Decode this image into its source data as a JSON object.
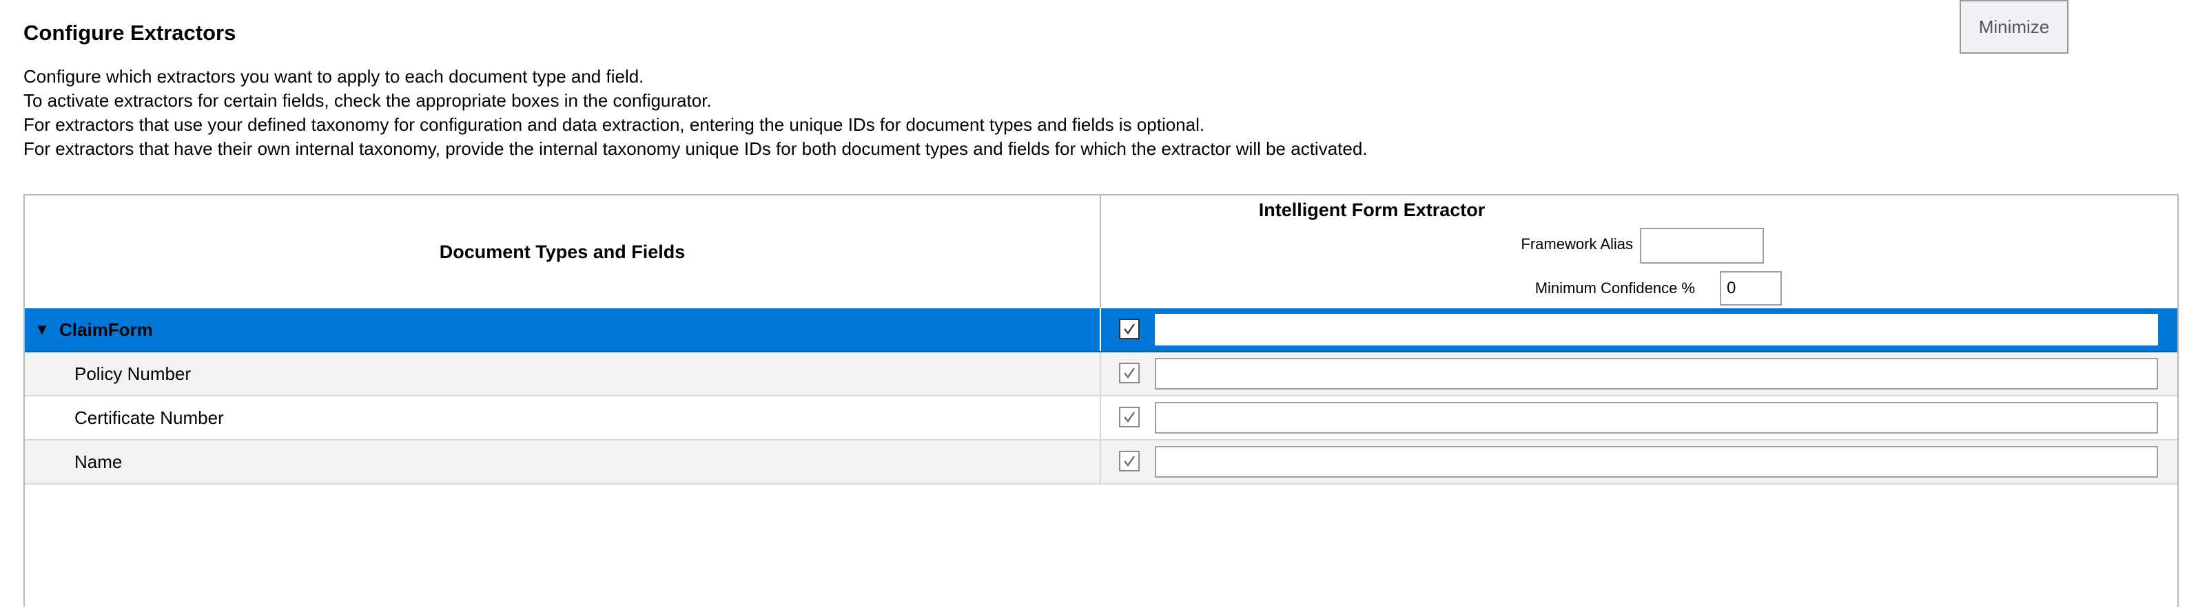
{
  "page": {
    "title": "Configure Extractors",
    "minimize_label": "Minimize",
    "description": [
      "Configure which extractors you want to apply to each document type and field.",
      "To activate extractors for certain fields, check the appropriate boxes in the configurator.",
      "For extractors that use your defined taxonomy for configuration and data extraction, entering the unique IDs for document types and fields is optional.",
      "For extractors that have their own internal taxonomy, provide the internal taxonomy unique IDs for both document types and fields for which the extractor will be activated."
    ]
  },
  "grid": {
    "left_header": "Document Types and Fields",
    "extractor": {
      "name": "Intelligent Form Extractor",
      "framework_alias_label": "Framework Alias",
      "framework_alias_value": "",
      "min_confidence_label": "Minimum Confidence %",
      "min_confidence_value": "0"
    },
    "rows": [
      {
        "label": "ClaimForm",
        "type": "document",
        "checked": true,
        "selected": true,
        "expanded": true,
        "id_value": ""
      },
      {
        "label": "Policy Number",
        "type": "field",
        "checked": true,
        "selected": false,
        "id_value": ""
      },
      {
        "label": "Certificate Number",
        "type": "field",
        "checked": true,
        "selected": false,
        "id_value": ""
      },
      {
        "label": "Name",
        "type": "field",
        "checked": true,
        "selected": false,
        "id_value": ""
      }
    ]
  },
  "icons": {
    "expand": "caret-down-icon",
    "check": "checkmark-icon"
  },
  "colors": {
    "selection": "#0078d7",
    "alt_row": "#f2f2f2",
    "border": "#b8b8b8"
  }
}
